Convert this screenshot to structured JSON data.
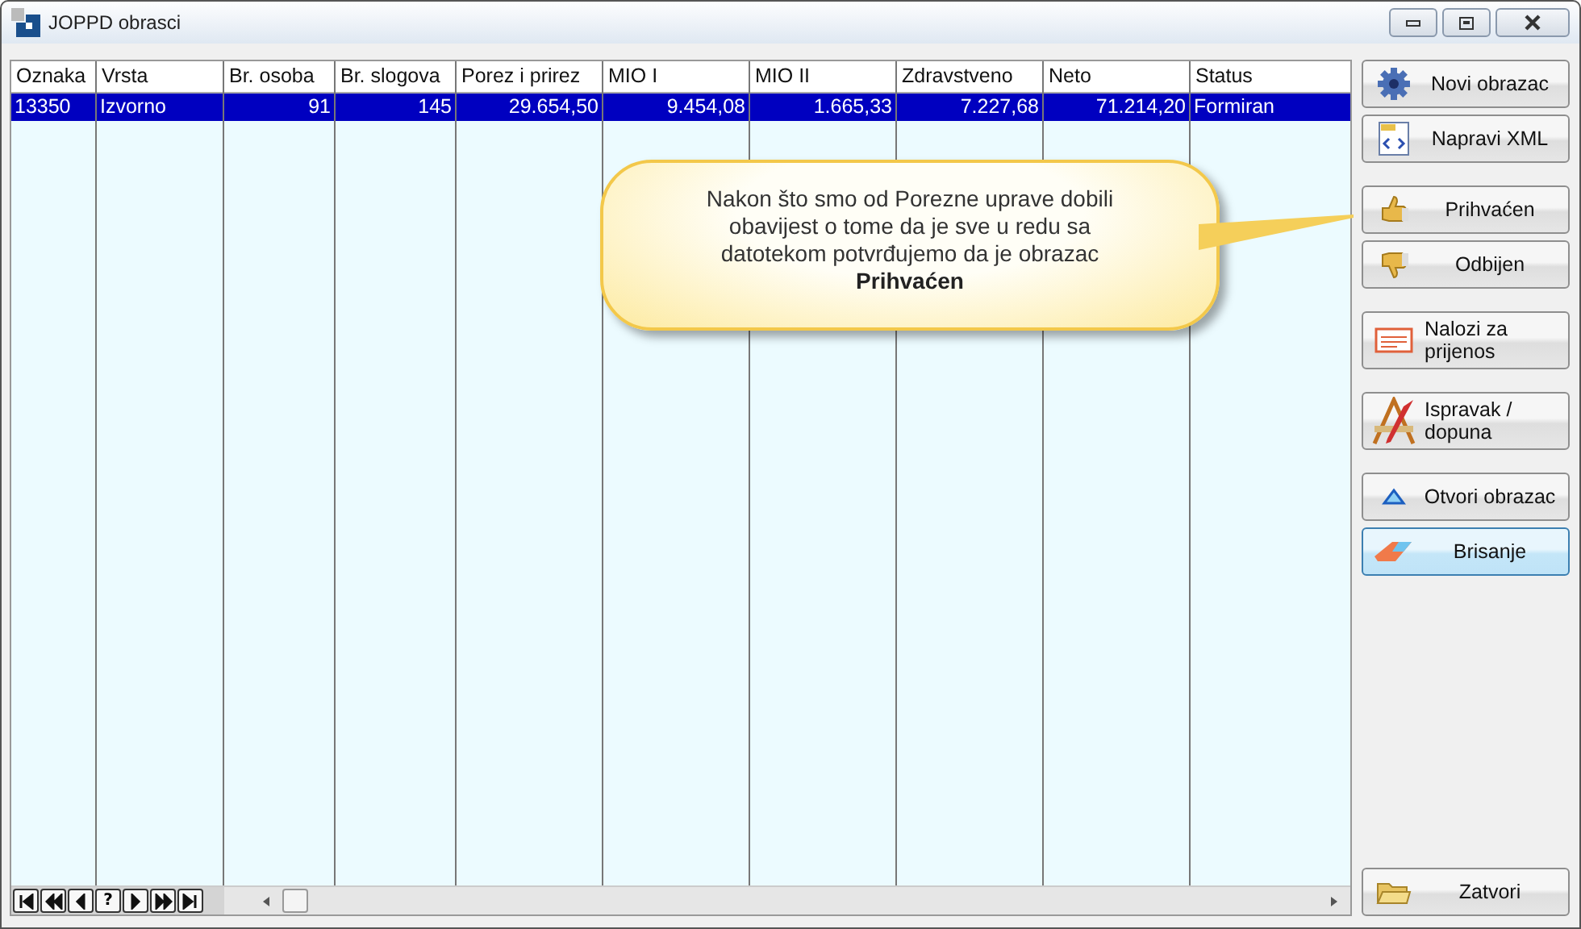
{
  "window": {
    "title": "JOPPD obrasci"
  },
  "table": {
    "columns": [
      {
        "label": "Oznaka"
      },
      {
        "label": "Vrsta"
      },
      {
        "label": "Br. osoba"
      },
      {
        "label": "Br. slogova"
      },
      {
        "label": "Porez i prirez"
      },
      {
        "label": "MIO I"
      },
      {
        "label": "MIO II"
      },
      {
        "label": "Zdravstveno"
      },
      {
        "label": "Neto"
      },
      {
        "label": "Status"
      }
    ],
    "rows": [
      {
        "selected": true,
        "cells": [
          "13350",
          "Izvorno",
          "91",
          "145",
          "29.654,50",
          "9.454,08",
          "1.665,33",
          "7.227,68",
          "71.214,20",
          "Formiran"
        ]
      }
    ]
  },
  "navigator": [
    {
      "kind": "first"
    },
    {
      "kind": "prev-page"
    },
    {
      "kind": "prev"
    },
    {
      "kind": "help",
      "label": "?"
    },
    {
      "kind": "next"
    },
    {
      "kind": "next-page"
    },
    {
      "kind": "last"
    }
  ],
  "callout": {
    "text": "Nakon što smo od Porezne uprave dobili obavijest o tome da je sve u redu sa datotekom potvrđujemo da je obrazac\n**Prihvaćen**"
  },
  "buttons": [
    {
      "label": "Novi obrazac",
      "highlighted": false
    },
    {
      "label": "Napravi XML",
      "highlighted": false
    },
    {
      "label": "Prihvaćen",
      "highlighted": false
    },
    {
      "label": "Odbijen",
      "highlighted": false
    },
    {
      "label": "Nalozi za prijenos",
      "highlighted": false
    },
    {
      "label": "Ispravak / dopuna",
      "highlighted": false
    },
    {
      "label": "Otvori obrazac",
      "highlighted": false
    },
    {
      "label": "Brisanje",
      "highlighted": true
    },
    {
      "label": "Zatvori",
      "highlighted": false
    }
  ]
}
